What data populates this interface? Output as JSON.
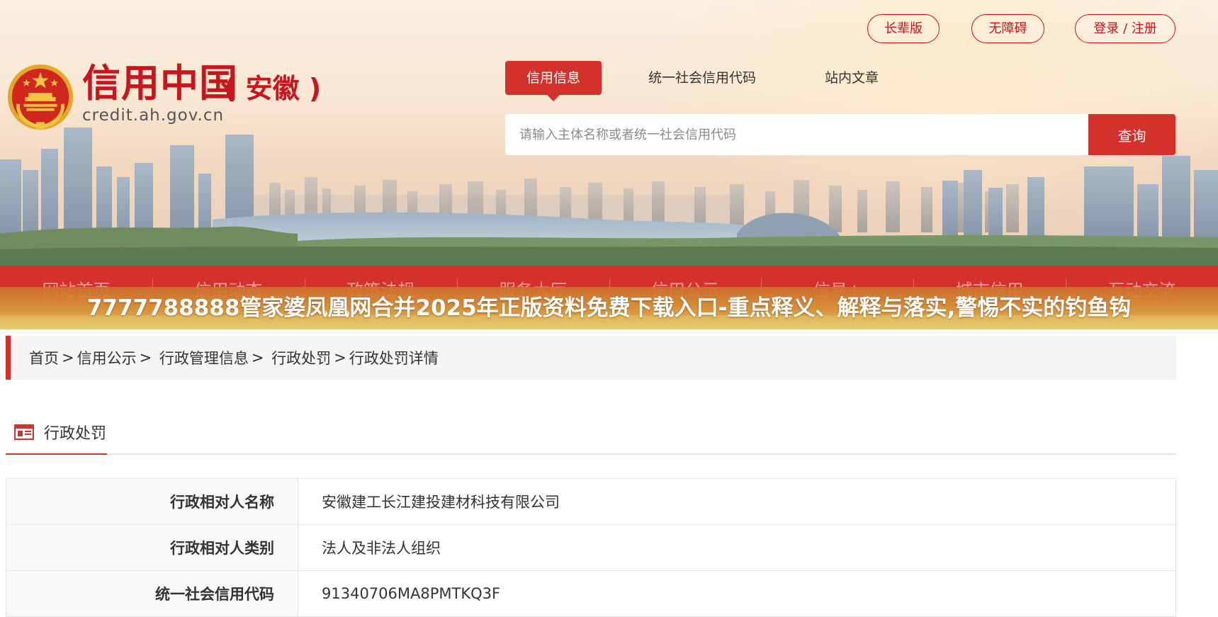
{
  "top_links": {
    "elder": "长辈版",
    "accessible": "无障碍",
    "login": "登录 / 注册"
  },
  "logo": {
    "title": "信用中国",
    "region": "( 安徽 )",
    "domain": "credit.ah.gov.cn"
  },
  "search": {
    "tabs": [
      "信用信息",
      "统一社会信用代码",
      "站内文章"
    ],
    "active_tab": "信用信息",
    "placeholder": "请输入主体名称或者统一社会信用代码",
    "button": "查询"
  },
  "main_nav": [
    "网站首页",
    "信用动态",
    "政策法规",
    "服务大厅",
    "信用公示",
    "信易+",
    "城市信用",
    "互动交流"
  ],
  "overlay_headline": "7777788888管家婆凤凰网合并2025年正版资料免费下载入口-重点释义、解释与落实,警惕不实的钓鱼钩",
  "breadcrumb": [
    "首页",
    "信用公示",
    "行政管理信息",
    "行政处罚",
    "行政处罚详情"
  ],
  "section": {
    "title": "行政处罚",
    "icon": "document-icon"
  },
  "details": [
    {
      "label": "行政相对人名称",
      "value": "安徽建工长江建投建材科技有限公司"
    },
    {
      "label": "行政相对人类别",
      "value": "法人及非法人组织"
    },
    {
      "label": "统一社会信用代码",
      "value": "91340706MA8PMTKQ3F"
    }
  ],
  "colors": {
    "brand_red": "#d4312c",
    "logo_red": "#c8161d",
    "overlay_orange": "#d69637"
  }
}
